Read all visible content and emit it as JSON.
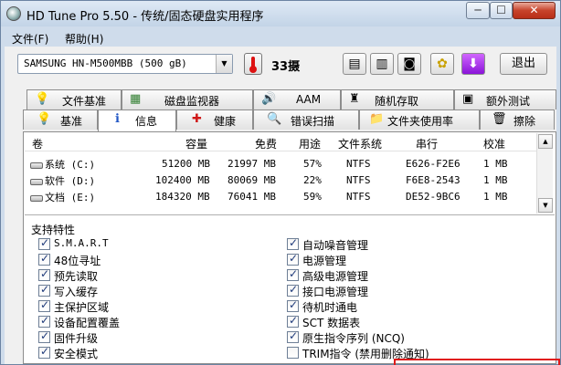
{
  "window": {
    "title": "HD Tune Pro 5.50 - 传统/固态硬盘实用程序"
  },
  "window_buttons": {
    "minimize": "─",
    "maximize": "☐",
    "close": "✕"
  },
  "menu": [
    "文件(F)",
    "帮助(H)"
  ],
  "toolbar": {
    "drive": "SAMSUNG HN-M500MBB (500 gB)",
    "temperature": "33摄",
    "exit_label": "退出",
    "icons": [
      "copy-text-icon",
      "copy-info-icon",
      "camera-icon",
      "health-icon",
      "save-icon"
    ]
  },
  "tabs_top": [
    {
      "icon": "file-benchmark-icon",
      "glyph": "💡",
      "label": "文件基准"
    },
    {
      "icon": "disk-monitor-icon",
      "glyph": "▦",
      "label": "磁盘监视器"
    },
    {
      "icon": "speaker-icon",
      "glyph": "🔊",
      "label": "AAM"
    },
    {
      "icon": "random-access-icon",
      "glyph": "♜",
      "label": "随机存取"
    },
    {
      "icon": "extra-tests-icon",
      "glyph": "▣",
      "label": "额外测试"
    }
  ],
  "tabs_bottom": [
    {
      "icon": "benchmark-icon",
      "glyph": "💡",
      "label": "基准"
    },
    {
      "icon": "info-icon",
      "glyph": "ℹ",
      "label": "信息"
    },
    {
      "icon": "health-cross-icon",
      "glyph": "✚",
      "label": "健康"
    },
    {
      "icon": "error-scan-icon",
      "glyph": "🔍",
      "label": "错误扫描"
    },
    {
      "icon": "folder-usage-icon",
      "glyph": "📁",
      "label": "文件夹使用率"
    },
    {
      "icon": "erase-icon",
      "glyph": "🗑",
      "label": "擦除"
    }
  ],
  "volumes": {
    "headers": [
      "卷",
      "容量",
      "免费",
      "用途",
      "文件系统",
      "串行",
      "校准"
    ],
    "rows": [
      [
        "系统 (C:)",
        "51200 MB",
        "21997 MB",
        "57%",
        "NTFS",
        "E626-F2E6",
        "1 MB"
      ],
      [
        "软件 (D:)",
        "102400 MB",
        "80069 MB",
        "22%",
        "NTFS",
        "F6E8-2543",
        "1 MB"
      ],
      [
        "文档 (E:)",
        "184320 MB",
        "76041 MB",
        "59%",
        "NTFS",
        "DE52-9BC6",
        "1 MB"
      ]
    ]
  },
  "features": {
    "title": "支持特性",
    "left": [
      {
        "label": "S.M.A.R.T",
        "checked": true
      },
      {
        "label": "48位寻址",
        "checked": true
      },
      {
        "label": "预先读取",
        "checked": true
      },
      {
        "label": "写入缓存",
        "checked": true
      },
      {
        "label": "主保护区域",
        "checked": true
      },
      {
        "label": "设备配置覆盖",
        "checked": true
      },
      {
        "label": "固件升级",
        "checked": true
      },
      {
        "label": "安全模式",
        "checked": true
      }
    ],
    "right": [
      {
        "label": "自动噪音管理",
        "checked": true
      },
      {
        "label": "电源管理",
        "checked": true
      },
      {
        "label": "高级电源管理",
        "checked": true
      },
      {
        "label": "接口电源管理",
        "checked": true
      },
      {
        "label": "待机时通电",
        "checked": true
      },
      {
        "label": "SCT 数据表",
        "checked": true
      },
      {
        "label": "原生指令序列 (NCQ)",
        "checked": true
      },
      {
        "label": "TRIM指令 (禁用删除通知)",
        "checked": false
      }
    ]
  }
}
